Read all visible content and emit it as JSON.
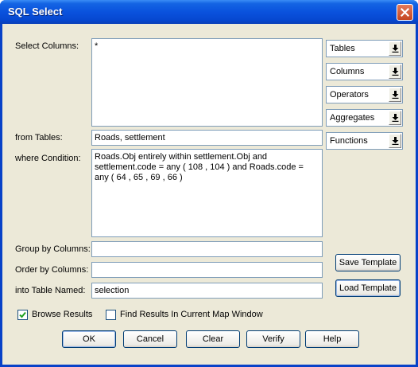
{
  "window": {
    "title": "SQL Select"
  },
  "labels": {
    "select_columns": "Select Columns:",
    "from_tables": "from Tables:",
    "where_condition": "where Condition:",
    "group_by": "Group by Columns:",
    "order_by": "Order by Columns:",
    "into_table": "into Table Named:"
  },
  "fields": {
    "select_columns": "*",
    "from_tables": "Roads, settlement",
    "where_condition": "Roads.Obj entirely within settlement.Obj and settlement.code = any ( 108 , 104 ) and Roads.code = any ( 64 , 65 , 69 , 66 )",
    "group_by": "",
    "order_by": "",
    "into_table": "selection"
  },
  "dropdowns": [
    "Tables",
    "Columns",
    "Operators",
    "Aggregates",
    "Functions"
  ],
  "template_buttons": {
    "save": "Save Template",
    "load": "Load Template"
  },
  "checkboxes": {
    "browse_results": {
      "label": "Browse Results",
      "checked": true
    },
    "find_results": {
      "label": "Find Results In Current Map Window",
      "checked": false
    }
  },
  "buttons": {
    "ok": "OK",
    "cancel": "Cancel",
    "clear": "Clear",
    "verify": "Verify",
    "help": "Help"
  },
  "colors": {
    "titlebar": "#0a52dd",
    "dialog_bg": "#ece9d8",
    "close_button": "#c5451f"
  }
}
